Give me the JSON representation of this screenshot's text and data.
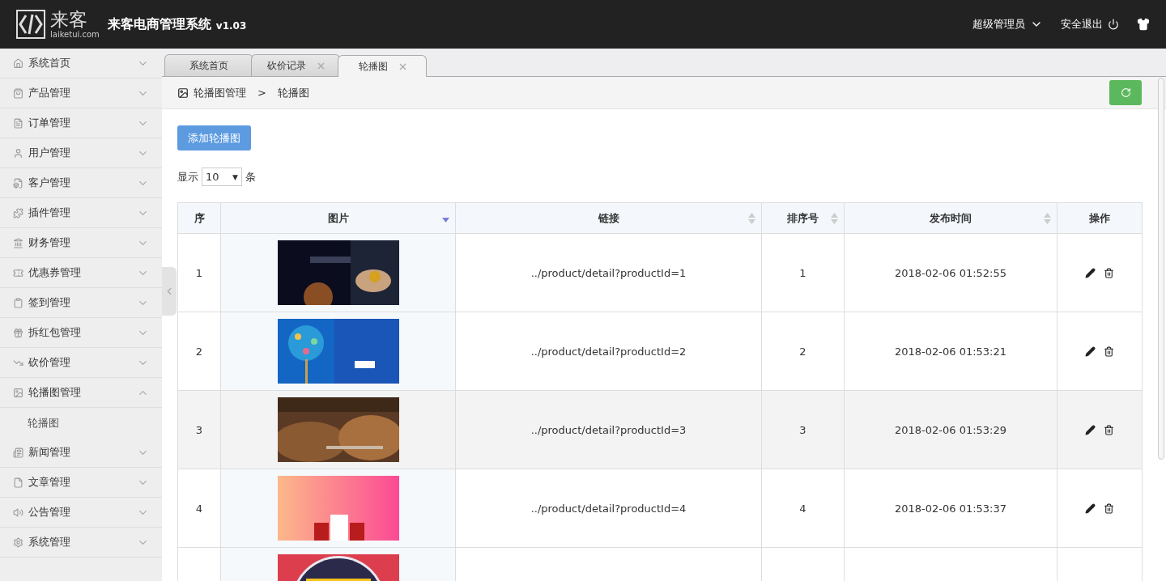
{
  "header": {
    "logo_text": "来客",
    "logo_domain": "laiketui.com",
    "title": "来客电商管理系统",
    "version": "v1.03",
    "user": "超级管理员",
    "logout": "安全退出"
  },
  "sidebar": {
    "items": [
      {
        "label": "系统首页",
        "expanded": false
      },
      {
        "label": "产品管理",
        "expanded": false
      },
      {
        "label": "订单管理",
        "expanded": false
      },
      {
        "label": "用户管理",
        "expanded": false
      },
      {
        "label": "客户管理",
        "expanded": false
      },
      {
        "label": "插件管理",
        "expanded": false
      },
      {
        "label": "财务管理",
        "expanded": false
      },
      {
        "label": "优惠券管理",
        "expanded": false
      },
      {
        "label": "签到管理",
        "expanded": false
      },
      {
        "label": "拆红包管理",
        "expanded": false
      },
      {
        "label": "砍价管理",
        "expanded": false
      },
      {
        "label": "轮播图管理",
        "expanded": true,
        "children": [
          {
            "label": "轮播图"
          }
        ]
      },
      {
        "label": "新闻管理",
        "expanded": false
      },
      {
        "label": "文章管理",
        "expanded": false
      },
      {
        "label": "公告管理",
        "expanded": false
      },
      {
        "label": "系统管理",
        "expanded": false
      }
    ]
  },
  "tabs": [
    {
      "label": "系统首页",
      "selected": false,
      "closable": false
    },
    {
      "label": "砍价记录",
      "selected": false,
      "closable": true
    },
    {
      "label": "轮播图",
      "selected": true,
      "closable": true
    }
  ],
  "breadcrumb": [
    "轮播图管理",
    "轮播图"
  ],
  "breadcrumb_separator": ">",
  "add_button": "添加轮播图",
  "page_size": {
    "prefix": "显示",
    "value": "10",
    "caret": "▼",
    "suffix": "条"
  },
  "table": {
    "columns": [
      {
        "label": "序"
      },
      {
        "label": "图片",
        "sortable": true,
        "sorted": true
      },
      {
        "label": "链接",
        "sortable": true,
        "sorted": false
      },
      {
        "label": "排序号",
        "sortable": true,
        "sorted": false
      },
      {
        "label": "发布时间",
        "sortable": true,
        "sorted": false
      },
      {
        "label": "操作"
      }
    ],
    "rows": [
      {
        "index": "1",
        "link": "../product/detail?productId=1",
        "order": "1",
        "time": "2018-02-06 01:52:55",
        "highlighted": false
      },
      {
        "index": "2",
        "link": "../product/detail?productId=2",
        "order": "2",
        "time": "2018-02-06 01:53:21",
        "highlighted": false
      },
      {
        "index": "3",
        "link": "../product/detail?productId=3",
        "order": "3",
        "time": "2018-02-06 01:53:29",
        "highlighted": true
      },
      {
        "index": "4",
        "link": "../product/detail?productId=4",
        "order": "4",
        "time": "2018-02-06 01:53:37",
        "highlighted": false
      },
      {
        "highlighted": false
      }
    ]
  }
}
